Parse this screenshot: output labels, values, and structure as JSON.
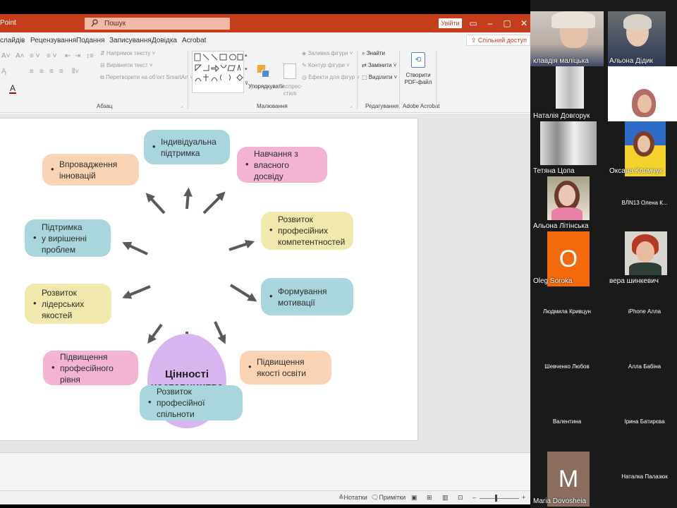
{
  "ppt": {
    "app_name": "Point",
    "search_placeholder": "Пошук",
    "signin_label": "Увійти",
    "share_label": "Спільний доступ",
    "ribbon_tabs": [
      "слайдів",
      "Рецензування",
      "Подання",
      "Записування",
      "Довідка",
      "Acrobat"
    ],
    "ribbon": {
      "text_direction": "Напрямок тексту",
      "align_text": "Вирівняти текст",
      "convert_smartart": "Перетворити на об'єкт SmartArt",
      "group_paragraph": "Абзац",
      "arrange": "Упорядкувати",
      "quick_styles": "Експрес-стилі",
      "shape_fill": "Заливка фігури",
      "shape_outline": "Контур фігури",
      "shape_effects": "Ефекти для фігур",
      "group_drawing": "Малювання",
      "find": "Знайти",
      "replace": "Замінити",
      "select": "Виділити",
      "group_editing": "Редагування",
      "create_pdf": "Створити PDF-файл",
      "group_acrobat": "Adobe Acrobat"
    },
    "status": {
      "notes": "Нотатки",
      "comments": "Примітки"
    }
  },
  "slide": {
    "center": "Цінності\nнаставництва",
    "nodes": [
      {
        "text": "Індивідуальна\nпідтримка",
        "color": "#a9d6dc"
      },
      {
        "text": "Навчання з\nвласного досвіду",
        "color": "#f3b3d2"
      },
      {
        "text": "Впровадження\nінновацій",
        "color": "#f9d3b4"
      },
      {
        "text": "Розвиток\nпрофесійних\nкомпетентностей",
        "color": "#f1e8ad"
      },
      {
        "text": "Підтримка\nу вирішенні проблем",
        "color": "#a9d6dc"
      },
      {
        "text": "Формування\nмотивації",
        "color": "#a9d6dc"
      },
      {
        "text": "Розвиток\nлідерських якостей",
        "color": "#f1e8ad"
      },
      {
        "text": "Підвищення\nякості освіти",
        "color": "#f9d3b4"
      },
      {
        "text": "Підвищення\nпрофесійного рівня",
        "color": "#f3b3d2"
      },
      {
        "text": "Розвиток професійної\nспільноти",
        "color": "#a9d6dc"
      }
    ]
  },
  "participants": [
    {
      "name": "клавдія маліцька"
    },
    {
      "name": "Альона Дідик"
    },
    {
      "name": "Наталія Довгорук"
    },
    {
      "name": ""
    },
    {
      "name": "Тетяна  Цопа"
    },
    {
      "name": "Оксана Клямчук"
    },
    {
      "name": "Альона Літінська"
    },
    {
      "name": "ВЛN13 Олена К..."
    },
    {
      "name": "Oleg Soroka",
      "initial": "O",
      "color": "#f26a0b"
    },
    {
      "name": "вера шинкевич"
    },
    {
      "name": "Людмила Кривцун"
    },
    {
      "name": "iPhone Алла"
    },
    {
      "name": "Шевченко Любов"
    },
    {
      "name": "Алла Бабіна"
    },
    {
      "name": "Валентина"
    },
    {
      "name": "Ірина Батирєва"
    },
    {
      "name": "Maria Dovosheia",
      "initial": "M",
      "color": "#8b6d60"
    },
    {
      "name": "Наталка Палазюк"
    }
  ]
}
